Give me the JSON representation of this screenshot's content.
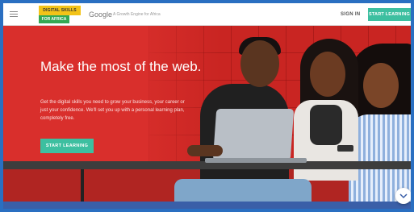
{
  "header": {
    "menu_icon": "hamburger-menu-icon",
    "logo_top": "DIGITAL SKILLS",
    "logo_bottom": "FOR AFRICA",
    "google": "Google",
    "google_tagline": "A Growth Engine for Africa",
    "sign_in": "SIGN IN",
    "start_learning": "START LEARNING"
  },
  "hero": {
    "headline": "Make the most of the web.",
    "subtext": "Get the digital skills you need to grow your business, your career or just your confidence. We'll set you up with a personal learning plan, completely free.",
    "cta": "START LEARNING"
  },
  "floating": {
    "icon": "chevron-down-icon"
  },
  "colors": {
    "hero_red": "#d92f2c",
    "accent_green": "#3dbfa0",
    "logo_yellow": "#f3c318",
    "frame_blue": "#2a6fc1"
  }
}
